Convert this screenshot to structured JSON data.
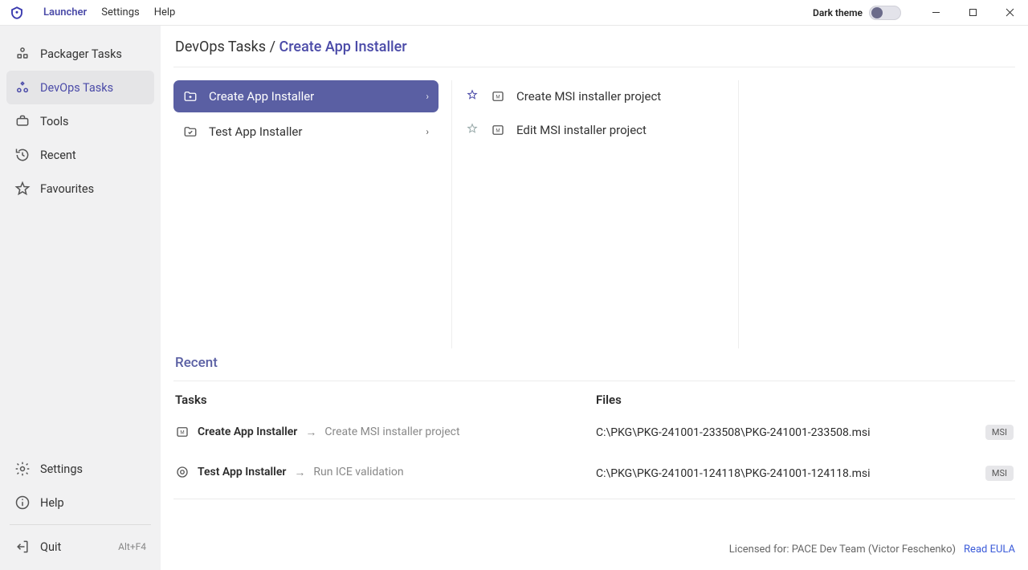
{
  "titlebar": {
    "app_name": "Launcher",
    "menu": {
      "settings": "Settings",
      "help": "Help"
    },
    "dark_theme_label": "Dark theme"
  },
  "sidebar": {
    "items": [
      {
        "label": "Packager Tasks"
      },
      {
        "label": "DevOps Tasks"
      },
      {
        "label": "Tools"
      },
      {
        "label": "Recent"
      },
      {
        "label": "Favourites"
      }
    ],
    "settings": "Settings",
    "help": "Help",
    "quit": "Quit",
    "quit_shortcut": "Alt+F4"
  },
  "breadcrumb": {
    "parent": "DevOps Tasks",
    "sep": "/",
    "current": "Create App Installer"
  },
  "tasks": {
    "col1": [
      {
        "label": "Create App Installer"
      },
      {
        "label": "Test App Installer"
      }
    ],
    "col2": [
      {
        "label": "Create MSI installer project",
        "fav": true
      },
      {
        "label": "Edit MSI installer project",
        "fav": false
      }
    ]
  },
  "recent": {
    "header": "Recent",
    "tasks_title": "Tasks",
    "files_title": "Files",
    "tasks": [
      {
        "name": "Create App Installer",
        "sub": "Create MSI installer project"
      },
      {
        "name": "Test App Installer",
        "sub": "Run ICE validation"
      }
    ],
    "files": [
      {
        "path": "C:\\PKG\\PKG-241001-233508\\PKG-241001-233508.msi",
        "badge": "MSI"
      },
      {
        "path": "C:\\PKG\\PKG-241001-124118\\PKG-241001-124118.msi",
        "badge": "MSI"
      }
    ]
  },
  "footer": {
    "license": "Licensed for: PACE Dev Team (Victor Feschenko)",
    "eula": "Read EULA"
  }
}
